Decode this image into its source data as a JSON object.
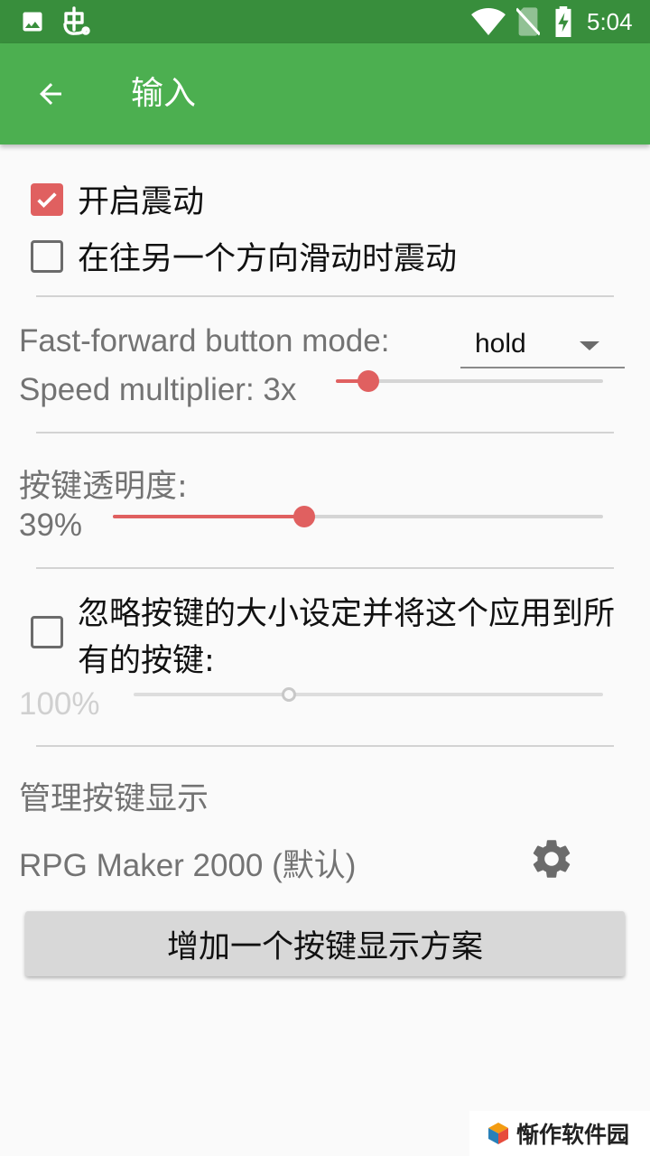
{
  "status_bar": {
    "time": "5:04",
    "icons": [
      "image-icon",
      "bug-icon",
      "wifi-icon",
      "no-sim-icon",
      "battery-charging-icon"
    ]
  },
  "app_bar": {
    "title": "输入",
    "back_icon": "arrow-back-icon"
  },
  "vibration": {
    "enable_label": "开启震动",
    "enable_checked": true,
    "swipe_label": "在往另一个方向滑动时震动",
    "swipe_checked": false
  },
  "fast_forward": {
    "mode_label": "Fast-forward button mode:",
    "mode_value": "hold",
    "speed_label": "Speed multiplier: 3x",
    "speed_fraction": 0.12
  },
  "opacity": {
    "label": "按键透明度:",
    "value_text": "39%",
    "fraction": 0.39
  },
  "ignore_size": {
    "label": "忽略按键的大小设定并将这个应用到所有的按键:",
    "checked": false,
    "value_text": "100%",
    "fraction": 0.33
  },
  "layouts": {
    "header": "管理按键显示",
    "item_label": "RPG Maker 2000 (默认)",
    "settings_icon": "gear-icon",
    "add_button": "增加一个按键显示方案"
  },
  "watermark": {
    "text": "惭作软件园"
  },
  "colors": {
    "status_bar": "#388e3c",
    "app_bar": "#4caf50",
    "accent": "#e06060"
  }
}
